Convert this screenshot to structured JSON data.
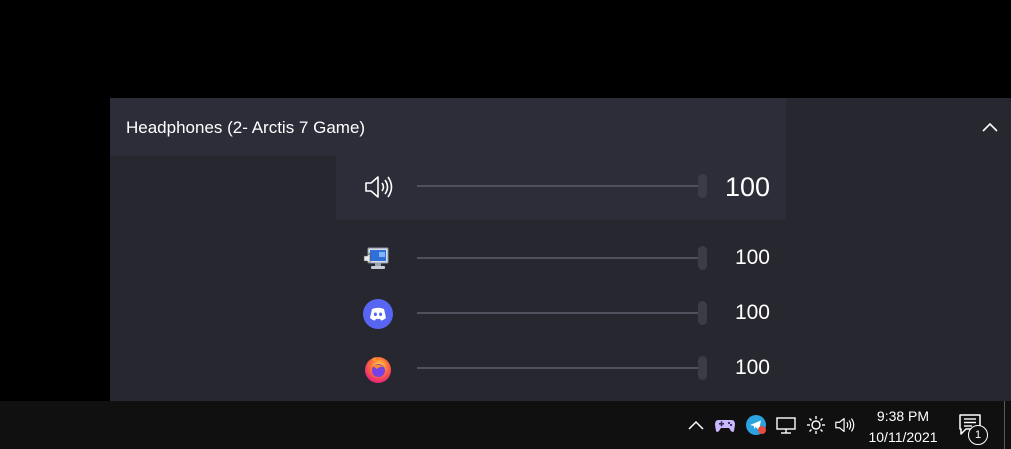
{
  "mixer": {
    "device_title": "Headphones (2- Arctis 7 Game)",
    "master": {
      "icon": "speaker-icon",
      "value": "100",
      "level": 1.0
    },
    "apps": [
      {
        "name": "system-sounds",
        "icon": "system-sounds-icon",
        "value": "100",
        "level": 1.0
      },
      {
        "name": "discord",
        "icon": "discord-icon",
        "value": "100",
        "level": 1.0
      },
      {
        "name": "firefox",
        "icon": "firefox-icon",
        "value": "100",
        "level": 1.0
      }
    ]
  },
  "taskbar": {
    "tray_icons": [
      "chevron-up-icon",
      "gamepad-icon",
      "telegram-icon",
      "network-icon",
      "brightness-icon",
      "volume-icon"
    ],
    "time": "9:38 PM",
    "date": "10/11/2021",
    "notification_count": "1"
  },
  "colors": {
    "panel": "#272730",
    "header": "#2c2d38",
    "discord": "#5865f2",
    "firefox_orange": "#ff7139",
    "taskbar": "#101010"
  }
}
